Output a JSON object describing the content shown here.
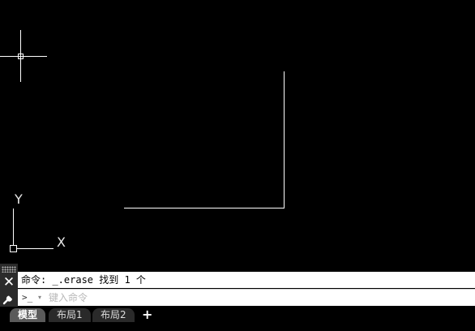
{
  "ucs": {
    "y_label": "Y",
    "x_label": "X"
  },
  "command_line": {
    "history_text": "命令: _.erase 找到 1 个",
    "prompt_symbol": ">_",
    "prompt_arrow": "▾",
    "input_placeholder": "键入命令",
    "input_value": "",
    "close_symbol": "✕"
  },
  "layout_tabs": {
    "items": [
      {
        "label": "模型",
        "active": true
      },
      {
        "label": "布局1",
        "active": false
      },
      {
        "label": "布局2",
        "active": false
      }
    ],
    "add_label": "+"
  },
  "colors": {
    "background": "#000000",
    "geometry": "#ffffff",
    "crosshair": "#ffffff"
  },
  "icons": {
    "close": "close-icon",
    "customize": "wrench-icon",
    "prompt": "command-prompt-icon",
    "grip": "grip-handle-icon"
  }
}
